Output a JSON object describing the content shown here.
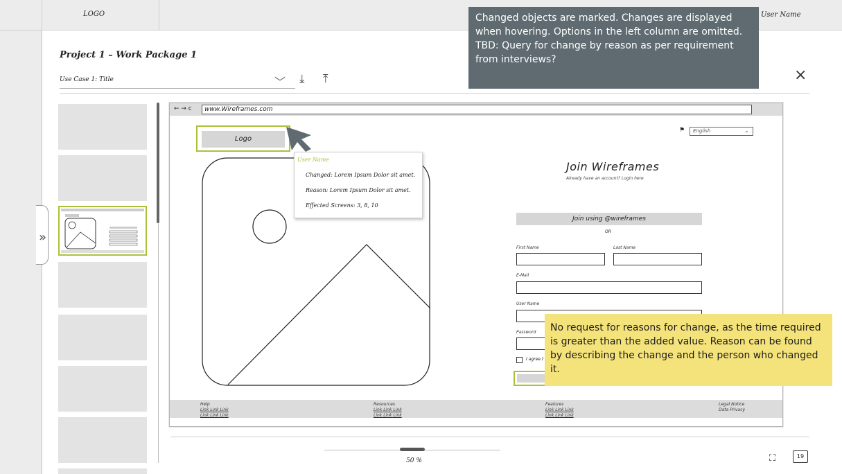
{
  "topbar": {
    "logo": "LOGO",
    "user_name": "User Name"
  },
  "header": {
    "project_title": "Project 1 – Work Package 1",
    "use_case": "Use Case 1: Title"
  },
  "icons": {
    "expand": "»",
    "download": "⤓",
    "upload": "⤒",
    "close": "×",
    "chevron": "﹀",
    "fullscreen": "⛶",
    "flag": "⚑"
  },
  "wireframe": {
    "nav": "← → c",
    "url": "www.Wireframes.com",
    "logo": "Logo",
    "language": "English",
    "join_title": "Join Wireframes",
    "join_sub": "Already have an account? Login here",
    "join_using": "Join using @wireframes",
    "or": "OR",
    "labels": {
      "first_name": "First Name",
      "last_name": "Last Name",
      "email": "E-Mail",
      "user_name": "User Name",
      "password": "Password"
    },
    "agree": "I agree t",
    "footer": [
      {
        "heading": "Help",
        "links": [
          "Link Link Link",
          "Link Link Link"
        ]
      },
      {
        "heading": "Resources",
        "links": [
          "Link Link Link",
          "Link Link Link"
        ]
      },
      {
        "heading": "Features",
        "links": [
          "Link Link Link",
          "Link Link Link"
        ]
      },
      {
        "heading": "Legal Notice",
        "links": [
          "Data Privacy"
        ]
      }
    ]
  },
  "change_tooltip": {
    "user": "User Name",
    "changed": "Changed: Lorem Ipsum Dolor sit amet.",
    "reason": "Reason: Lorem Ipsum Dolor sit amet.",
    "screens": "Effected Screens: 3, 8, 10"
  },
  "notes": {
    "gray": "Changed objects are marked. Changes are displayed when hovering. Options in the left column are omitted.\nTBD: Query for change by reason as per requirement from interviews?",
    "yellow": "No request for reasons for change, as the time required is greater than the added value. Reason can be found by describing the change and the person who changed it."
  },
  "bottom": {
    "zoom": "50 %",
    "book": "19"
  },
  "colors": {
    "accent": "#a8c339",
    "note_gray": "#5f6b70",
    "note_yellow": "#f4e27a"
  }
}
